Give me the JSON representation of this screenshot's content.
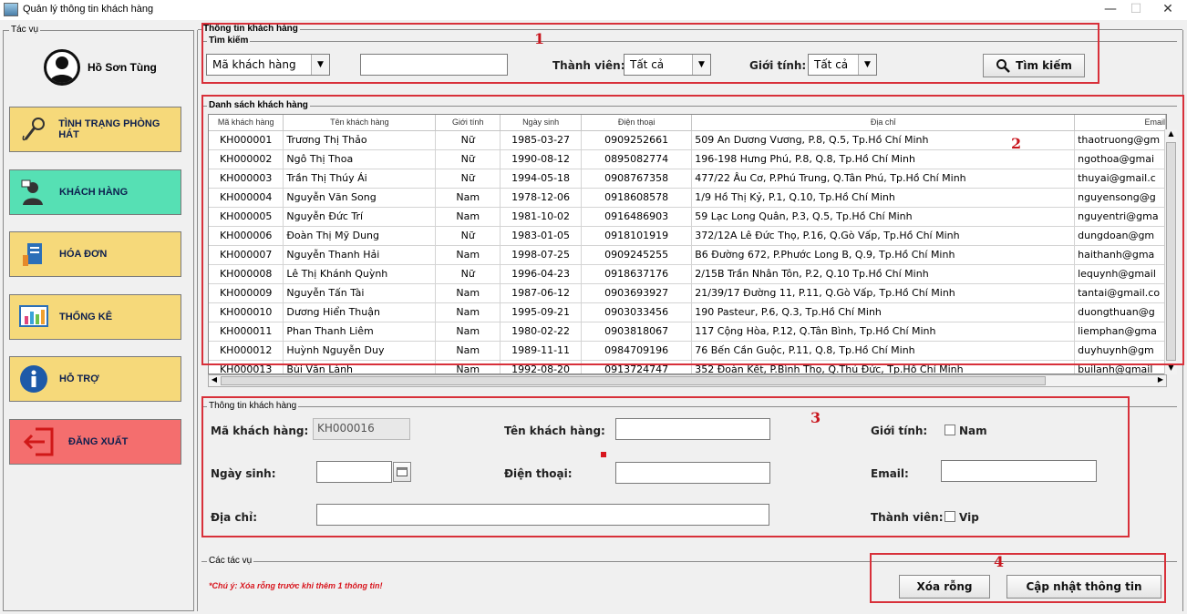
{
  "window": {
    "title": "Quản lý thông tin khách hàng",
    "minimize": "—",
    "maximize": "☐",
    "close": "✕"
  },
  "sidebar": {
    "title": "Tác vụ",
    "user_name": "Hồ Sơn Tùng",
    "items": [
      {
        "label": "TÌNH TRẠNG PHÒNG HÁT",
        "icon": "microphone-icon"
      },
      {
        "label": "KHÁCH HÀNG",
        "icon": "customer-icon"
      },
      {
        "label": "HÓA ĐƠN",
        "icon": "invoice-icon"
      },
      {
        "label": "THỐNG KÊ",
        "icon": "statistics-icon"
      },
      {
        "label": "HỖ TRỢ",
        "icon": "info-icon"
      },
      {
        "label": "ĐĂNG XUẤT",
        "icon": "logout-icon"
      }
    ],
    "active_item": "KHÁCH HÀNG"
  },
  "search": {
    "group_title": "Thông tin khách hàng",
    "subgroup_title": "Tìm kiếm",
    "field_combo": "Mã khách hàng",
    "keyword": "",
    "member_label": "Thành viên:",
    "member_value": "Tất cả",
    "gender_label": "Giới tính:",
    "gender_value": "Tất cả",
    "search_button": "Tìm kiếm"
  },
  "list": {
    "title": "Danh sách khách hàng",
    "columns": [
      "Mã khách hàng",
      "Tên khách hàng",
      "Giới tính",
      "Ngày sinh",
      "Điện thoại",
      "Địa chỉ",
      "Email"
    ],
    "rows": [
      [
        "KH000001",
        "Trương Thị Thảo",
        "Nữ",
        "1985-03-27",
        "0909252661",
        "509 An Dương Vương, P.8, Q.5, Tp.Hồ Chí Minh",
        "thaotruong@gm"
      ],
      [
        "KH000002",
        "Ngô Thị Thoa",
        "Nữ",
        "1990-08-12",
        "0895082774",
        "196-198 Hưng Phú, P.8, Q.8, Tp.Hồ Chí Minh",
        "ngothoa@gmai"
      ],
      [
        "KH000003",
        "Trần Thị Thúy Ái",
        "Nữ",
        "1994-05-18",
        "0908767358",
        "477/22 Âu Cơ, P.Phú Trung, Q.Tân Phú, Tp.Hồ Chí Minh",
        "thuyai@gmail.c"
      ],
      [
        "KH000004",
        "Nguyễn Văn Song",
        "Nam",
        "1978-12-06",
        "0918608578",
        "1/9 Hồ Thị Kỷ, P.1, Q.10, Tp.Hồ Chí Minh",
        "nguyensong@g"
      ],
      [
        "KH000005",
        "Nguyễn Đức Trí",
        "Nam",
        "1981-10-02",
        "0916486903",
        "59 Lạc Long Quân, P.3, Q.5, Tp.Hồ Chí Minh",
        "nguyentri@gma"
      ],
      [
        "KH000006",
        "Đoàn Thị Mỹ Dung",
        "Nữ",
        "1983-01-05",
        "0918101919",
        "372/12A Lê Đức Thọ, P.16, Q.Gò Vấp, Tp.Hồ Chí Minh",
        "dungdoan@gm"
      ],
      [
        "KH000007",
        "Nguyễn Thanh Hải",
        "Nam",
        "1998-07-25",
        "0909245255",
        "B6 Đường 672, P.Phước Long B, Q.9, Tp.Hồ Chí Minh",
        "haithanh@gma"
      ],
      [
        "KH000008",
        "Lê Thị Khánh Quỳnh",
        "Nữ",
        "1996-04-23",
        "0918637176",
        "2/15B Trần Nhân Tôn, P.2, Q.10 Tp.Hồ Chí Minh",
        "lequynh@gmail"
      ],
      [
        "KH000009",
        "Nguyễn Tấn Tài",
        "Nam",
        "1987-06-12",
        "0903693927",
        "21/39/17 Đường 11, P.11, Q.Gò Vấp, Tp.Hồ Chí Minh",
        "tantai@gmail.co"
      ],
      [
        "KH000010",
        "Dương Hiển Thuận",
        "Nam",
        "1995-09-21",
        "0903033456",
        "190 Pasteur, P.6, Q.3, Tp.Hồ Chí Minh",
        "duongthuan@g"
      ],
      [
        "KH000011",
        "Phan Thanh Liêm",
        "Nam",
        "1980-02-22",
        "0903818067",
        "117 Cộng Hòa, P.12, Q.Tân Bình, Tp.Hồ Chí Minh",
        "liemphan@gma"
      ],
      [
        "KH000012",
        "Huỳnh Nguyễn Duy",
        "Nam",
        "1989-11-11",
        "0984709196",
        "76 Bến Cần Guộc, P.11, Q.8, Tp.Hồ Chí Minh",
        "duyhuynh@gm"
      ],
      [
        "KH000013",
        "Bùi Văn Lành",
        "Nam",
        "1992-08-20",
        "0913724747",
        "352 Đoàn Kết, P.Bình Thọ, Q.Thủ Đức, Tp.Hồ Chí Minh",
        "builanh@gmail"
      ]
    ]
  },
  "form": {
    "title": "Thông tin khách hàng",
    "customer_id_label": "Mã khách hàng:",
    "customer_id_value": "KH000016",
    "name_label": "Tên khách hàng:",
    "name_value": "",
    "gender_label": "Giới tính:",
    "gender_checkbox": "Nam",
    "dob_label": "Ngày sinh:",
    "dob_value": "",
    "phone_label": "Điện thoại:",
    "phone_value": "",
    "email_label": "Email:",
    "email_value": "",
    "address_label": "Địa chỉ:",
    "address_value": "",
    "member_label": "Thành viên:",
    "member_checkbox": "Vip"
  },
  "actions": {
    "title": "Các tác vụ",
    "note": "*Chú ý: Xóa rỗng trước khi thêm 1 thông tin!",
    "clear_button": "Xóa rỗng",
    "update_button": "Cập nhật thông tin"
  },
  "annotations": [
    "1",
    "2",
    "3",
    "4"
  ],
  "colors": {
    "annotation_red": "#d8303a",
    "note_red": "#d8161e",
    "sidebar_yellow": "#f6d97a",
    "sidebar_green": "#56e0b4",
    "sidebar_red": "#f46e6e"
  }
}
